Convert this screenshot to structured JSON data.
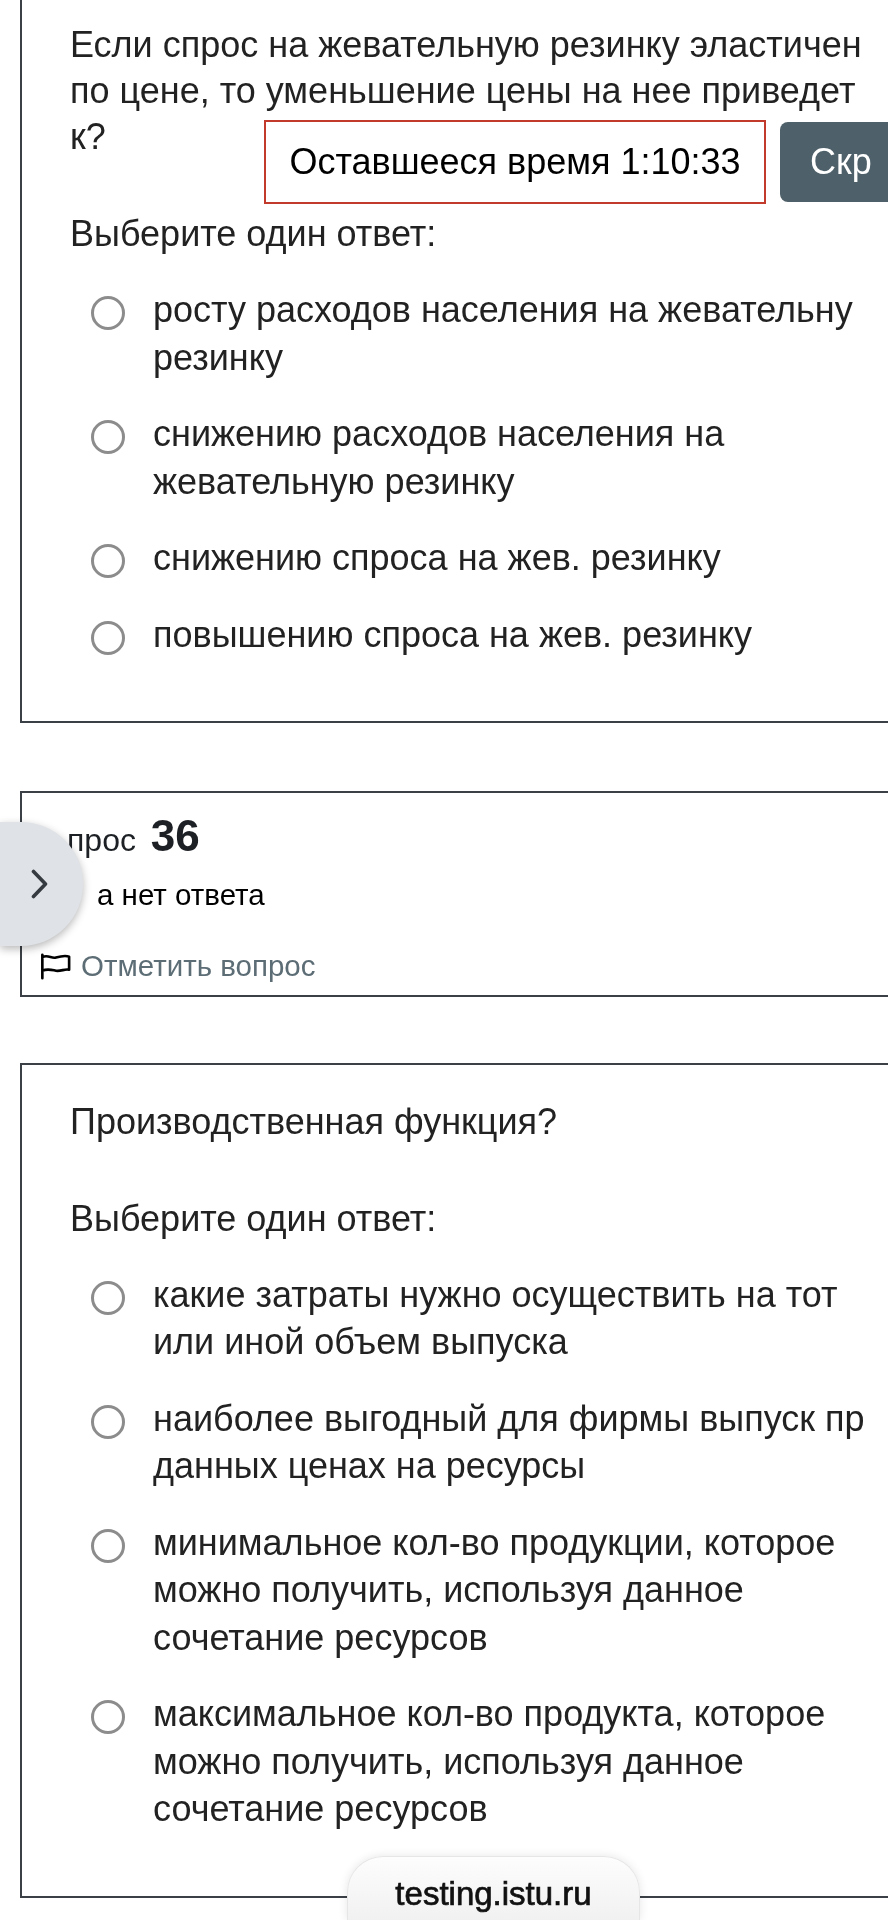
{
  "timer": {
    "label": "Оставшееся время 1:10:33",
    "button": "Скр"
  },
  "questions": [
    {
      "text": "Если спрос на жевательную резинку эластичен по цене, то уменьшение цены на нее приведет к?",
      "prompt": "Выберите один ответ:",
      "options": [
        {
          "text": "росту расходов населения на жевательну резинку",
          "selected": false
        },
        {
          "text": "снижению расходов населения на жевательную резинку",
          "selected": false
        },
        {
          "text": "снижению спроса на жев. резинку",
          "selected": false
        },
        {
          "text": "повышению спроса на жев. резинку",
          "selected": false
        }
      ]
    },
    {
      "info": {
        "title": "прос **36**",
        "state": "а нет ответа",
        "flag_link": "Отметить вопрос",
        "flagged": false
      },
      "text": "Производственная функция?",
      "prompt": "Выберите один ответ:",
      "options": [
        {
          "text": "какие затраты нужно осуществить на тот или иной объем выпуска",
          "selected": false
        },
        {
          "text": "наиболее выгодный для фирмы выпуск пр данных ценах на ресурсы",
          "selected": false
        },
        {
          "text": "минимальное кол-во продукции, которое можно получить, используя данное сочетание ресурсов",
          "selected": false
        },
        {
          "text": "максимальное кол-во продукта, которое можно получить, используя данное сочетание ресурсов",
          "selected": false
        }
      ]
    }
  ],
  "address_bar": {
    "url": "testing.istu.ru"
  }
}
